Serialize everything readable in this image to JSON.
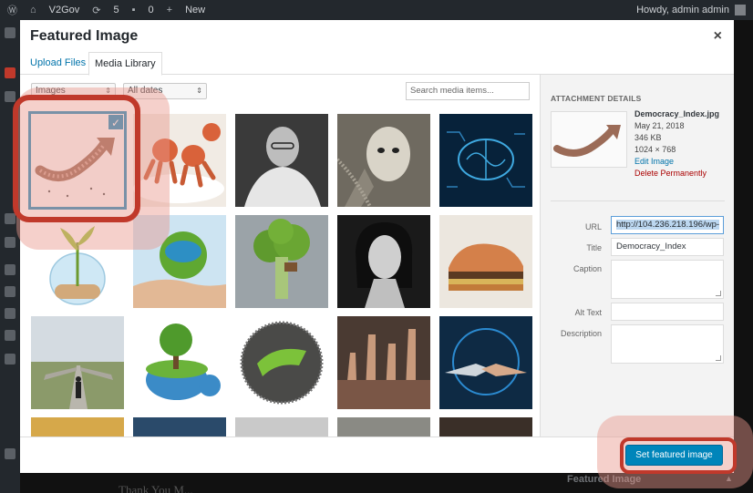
{
  "adminbar": {
    "site_name": "V2Gov",
    "updates": "5",
    "comments": "0",
    "new_label": "New",
    "howdy": "Howdy, admin admin"
  },
  "background": {
    "featured_panel_title": "Featured Image",
    "post_text_fragment": "Thank You M..."
  },
  "modal": {
    "title": "Featured Image",
    "close_glyph": "×",
    "tabs": [
      {
        "label": "Upload Files",
        "active": false
      },
      {
        "label": "Media Library",
        "active": true
      }
    ],
    "filters": {
      "type_selected": "Images",
      "date_selected": "All dates",
      "search_placeholder": "Search media items..."
    },
    "grid": {
      "items": [
        {
          "name": "crowd-arrow",
          "selected": true
        },
        {
          "name": "sausage-octopus"
        },
        {
          "name": "gandhi-portrait"
        },
        {
          "name": "digital-face"
        },
        {
          "name": "circuit-brain"
        },
        {
          "name": "plant-fishbowl"
        },
        {
          "name": "hand-globe"
        },
        {
          "name": "broccoli-treehouse"
        },
        {
          "name": "hedy-lamarr-portrait"
        },
        {
          "name": "sneaker-sandwich"
        },
        {
          "name": "man-crossroads"
        },
        {
          "name": "tree-planet"
        },
        {
          "name": "crowd-sphere"
        },
        {
          "name": "raised-hands"
        },
        {
          "name": "robot-handshake"
        },
        {
          "name": "partial-1"
        },
        {
          "name": "partial-2"
        },
        {
          "name": "partial-3"
        },
        {
          "name": "partial-4"
        },
        {
          "name": "partial-5"
        }
      ]
    },
    "details": {
      "heading": "ATTACHMENT DETAILS",
      "filename": "Democracy_Index.jpg",
      "date": "May 21, 2018",
      "size": "346 KB",
      "dimensions": "1024 × 768",
      "edit_link": "Edit Image",
      "delete_link": "Delete Permanently",
      "fields": {
        "url_label": "URL",
        "url_value": "http://104.236.218.196/wp-",
        "title_label": "Title",
        "title_value": "Democracy_Index",
        "caption_label": "Caption",
        "caption_value": "",
        "alt_label": "Alt Text",
        "alt_value": "",
        "description_label": "Description",
        "description_value": ""
      }
    },
    "footer": {
      "set_button_label": "Set featured image"
    }
  },
  "colors": {
    "accent": "#0085ba",
    "selection": "#1e8cbe",
    "annotation": "#c0392b",
    "admin_bar": "#23282d"
  }
}
